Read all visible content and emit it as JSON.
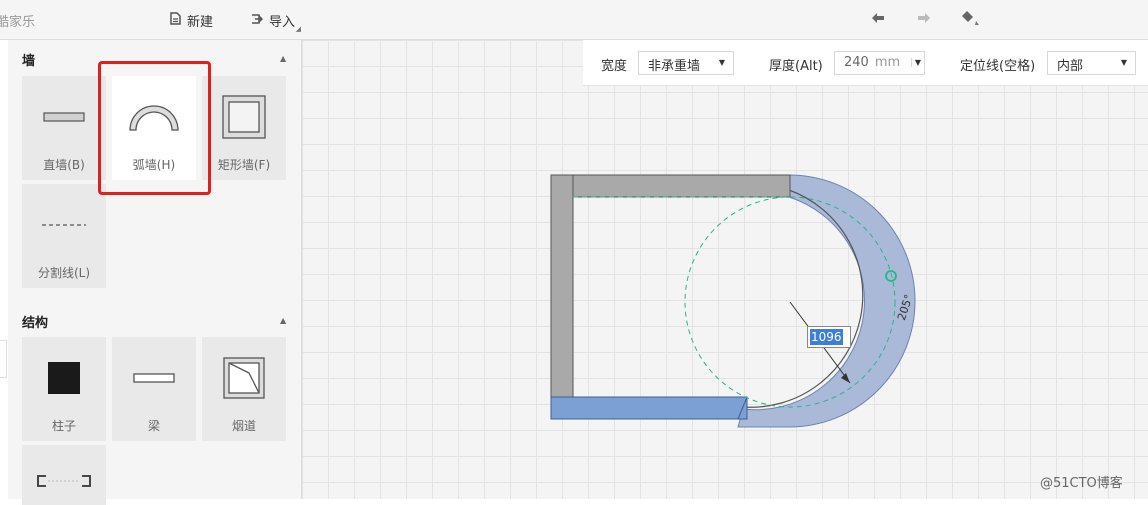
{
  "topbar": {
    "brand": "酷家乐",
    "new_label": "新建",
    "import_label": "导入",
    "icons": [
      "document-icon",
      "import-icon",
      "undo-icon",
      "redo-icon",
      "eraser-icon"
    ]
  },
  "props": {
    "width_label": "宽度",
    "width_value": "非承重墙",
    "thickness_label": "厚度(Alt)",
    "thickness_value": "240",
    "thickness_unit": "mm",
    "position_label": "定位线(空格)",
    "position_value": "内部"
  },
  "sidebar": {
    "wall_section": {
      "title": "墙",
      "items": [
        {
          "label": "直墙(B)",
          "icon": "straight-wall-icon"
        },
        {
          "label": "弧墙(H)",
          "icon": "arc-wall-icon",
          "selected": true
        },
        {
          "label": "矩形墙(F)",
          "icon": "rect-wall-icon"
        },
        {
          "label": "分割线(L)",
          "icon": "dashed-line-icon"
        }
      ]
    },
    "structure_section": {
      "title": "结构",
      "items": [
        {
          "label": "柱子",
          "icon": "column-icon"
        },
        {
          "label": "梁",
          "icon": "beam-icon"
        },
        {
          "label": "烟道",
          "icon": "flue-icon"
        },
        {
          "label": "",
          "icon": "opening-icon"
        }
      ]
    }
  },
  "canvas": {
    "radius_input": "1096",
    "angle_label": "205°"
  },
  "watermark": "@51CTO博客",
  "colors": {
    "wall_gray": "#a9a9a9",
    "arc_wall_blue": "#aab9d8",
    "selected_blue": "#7c9fd4",
    "guide_green": "#27b58a",
    "highlight": "#e0201a"
  }
}
